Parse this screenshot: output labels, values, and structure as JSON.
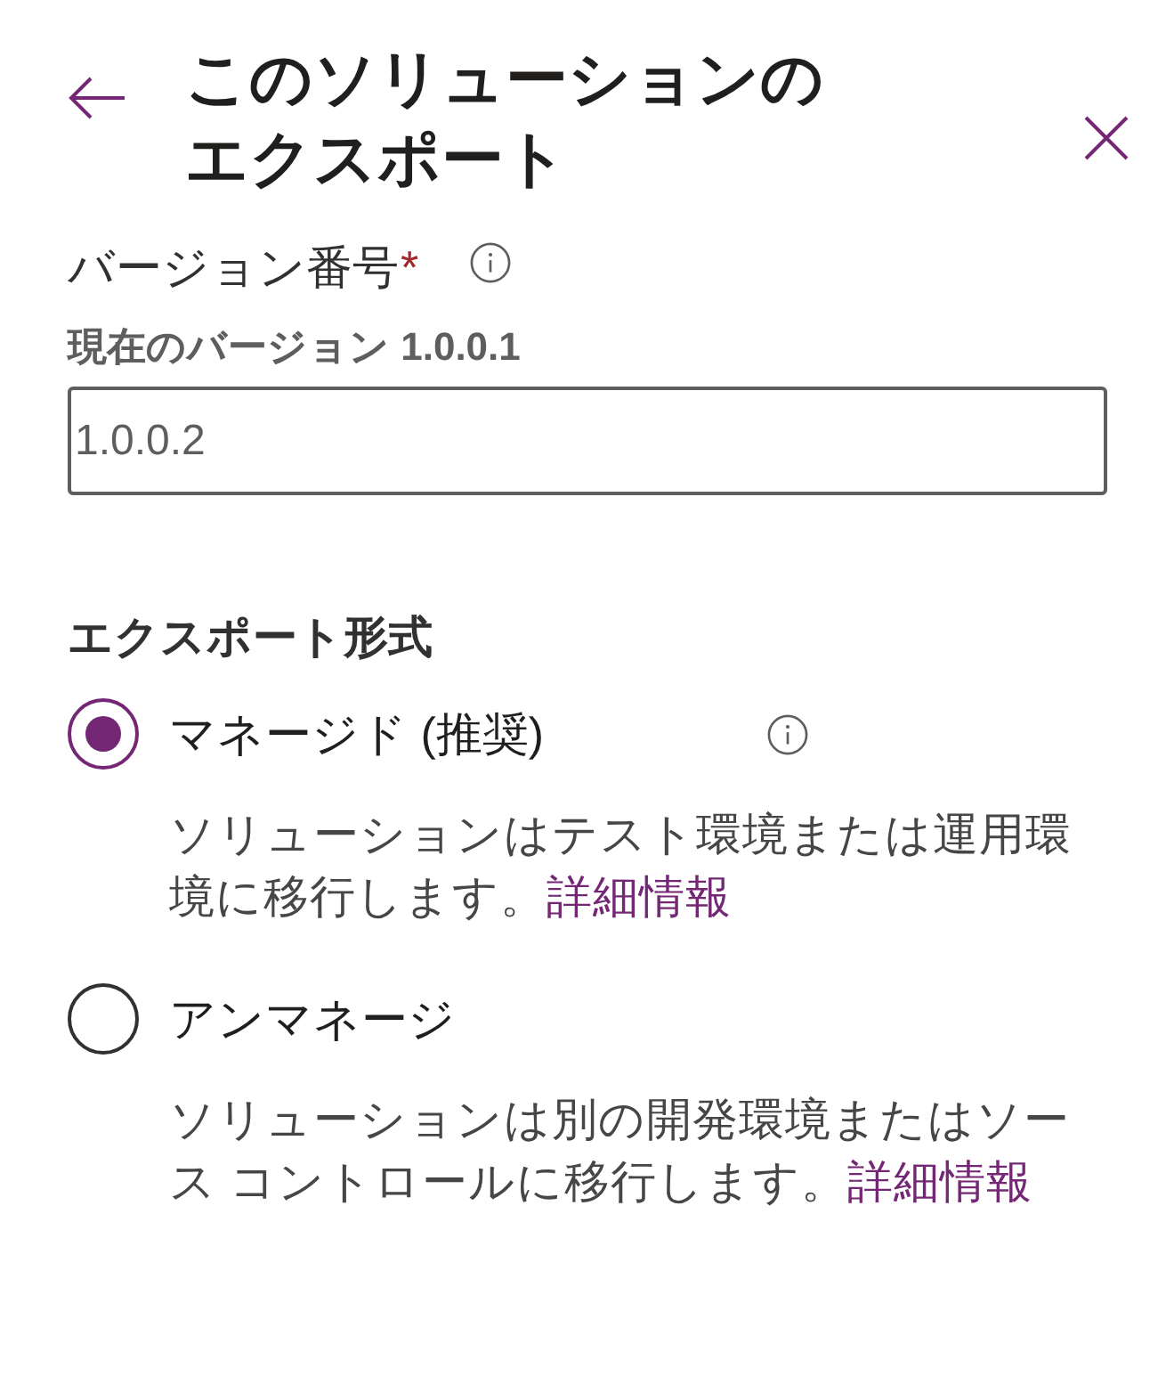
{
  "header": {
    "title": "このソリューションのエクスポート"
  },
  "version": {
    "label": "バージョン番号",
    "required_mark": "*",
    "info": true,
    "current": "現在のバージョン 1.0.0.1",
    "value": "1.0.0.2"
  },
  "export_format": {
    "heading": "エクスポート形式",
    "options": [
      {
        "label": "マネージド (推奨)",
        "selected": true,
        "info": true,
        "description": "ソリューションはテスト環境または運用環境に移行します。",
        "link": "詳細情報"
      },
      {
        "label": "アンマネージ",
        "selected": false,
        "info": false,
        "description": "ソリューションは別の開発環境またはソース コントロールに移行します。",
        "link": "詳細情報"
      }
    ]
  }
}
